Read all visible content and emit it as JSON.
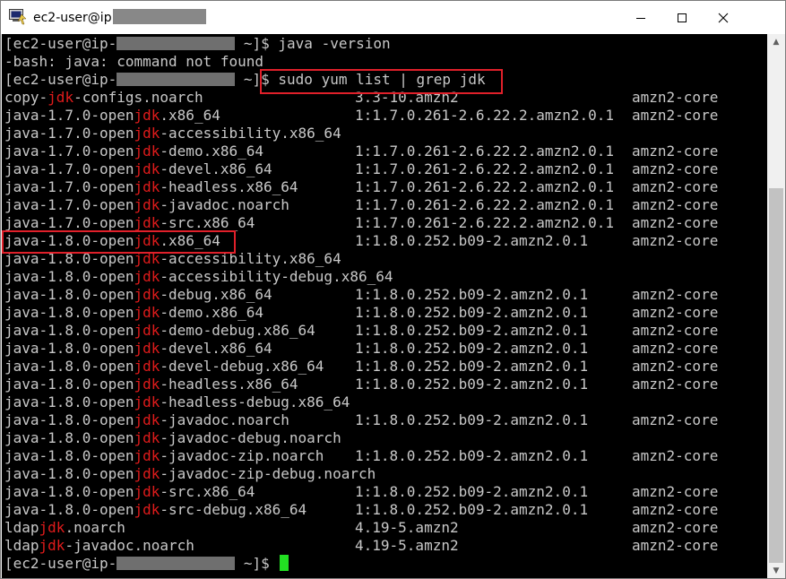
{
  "window": {
    "title": "ec2-user@ip",
    "controls": {
      "minimize": "minimize-icon",
      "maximize": "maximize-icon",
      "close": "close-icon"
    }
  },
  "colors": {
    "terminal_bg": "#000000",
    "terminal_fg": "#c8c8c8",
    "grep_match": "#e01b1b",
    "highlight_box": "#e0202a",
    "cursor": "#22e022"
  },
  "prompt": {
    "user_part": "[ec2-user@ip-",
    "dir_part": " ~]$ "
  },
  "terminal": {
    "cmd1": "java -version",
    "error_line": "-bash: java: command not found",
    "cmd2": "sudo yum list | grep jdk",
    "grep_term": "jdk",
    "packages": [
      {
        "pre": "copy-",
        "post": "-configs.noarch",
        "version": "3.3-10.amzn2",
        "repo": "amzn2-core"
      },
      {
        "pre": "java-1.7.0-open",
        "post": ".x86_64",
        "version": "1:1.7.0.261-2.6.22.2.amzn2.0.1",
        "repo": "amzn2-core"
      },
      {
        "pre": "java-1.7.0-open",
        "post": "-accessibility.x86_64",
        "version": "",
        "repo": ""
      },
      {
        "pre": "java-1.7.0-open",
        "post": "-demo.x86_64",
        "version": "1:1.7.0.261-2.6.22.2.amzn2.0.1",
        "repo": "amzn2-core"
      },
      {
        "pre": "java-1.7.0-open",
        "post": "-devel.x86_64",
        "version": "1:1.7.0.261-2.6.22.2.amzn2.0.1",
        "repo": "amzn2-core"
      },
      {
        "pre": "java-1.7.0-open",
        "post": "-headless.x86_64",
        "version": "1:1.7.0.261-2.6.22.2.amzn2.0.1",
        "repo": "amzn2-core"
      },
      {
        "pre": "java-1.7.0-open",
        "post": "-javadoc.noarch",
        "version": "1:1.7.0.261-2.6.22.2.amzn2.0.1",
        "repo": "amzn2-core"
      },
      {
        "pre": "java-1.7.0-open",
        "post": "-src.x86_64",
        "version": "1:1.7.0.261-2.6.22.2.amzn2.0.1",
        "repo": "amzn2-core"
      },
      {
        "pre": "java-1.8.0-open",
        "post": ".x86_64",
        "version": "1:1.8.0.252.b09-2.amzn2.0.1",
        "repo": "amzn2-core"
      },
      {
        "pre": "java-1.8.0-open",
        "post": "-accessibility.x86_64",
        "version": "",
        "repo": ""
      },
      {
        "pre": "java-1.8.0-open",
        "post": "-accessibility-debug.x86_64",
        "version": "",
        "repo": ""
      },
      {
        "pre": "java-1.8.0-open",
        "post": "-debug.x86_64",
        "version": "1:1.8.0.252.b09-2.amzn2.0.1",
        "repo": "amzn2-core"
      },
      {
        "pre": "java-1.8.0-open",
        "post": "-demo.x86_64",
        "version": "1:1.8.0.252.b09-2.amzn2.0.1",
        "repo": "amzn2-core"
      },
      {
        "pre": "java-1.8.0-open",
        "post": "-demo-debug.x86_64",
        "version": "1:1.8.0.252.b09-2.amzn2.0.1",
        "repo": "amzn2-core"
      },
      {
        "pre": "java-1.8.0-open",
        "post": "-devel.x86_64",
        "version": "1:1.8.0.252.b09-2.amzn2.0.1",
        "repo": "amzn2-core"
      },
      {
        "pre": "java-1.8.0-open",
        "post": "-devel-debug.x86_64",
        "version": "1:1.8.0.252.b09-2.amzn2.0.1",
        "repo": "amzn2-core"
      },
      {
        "pre": "java-1.8.0-open",
        "post": "-headless.x86_64",
        "version": "1:1.8.0.252.b09-2.amzn2.0.1",
        "repo": "amzn2-core"
      },
      {
        "pre": "java-1.8.0-open",
        "post": "-headless-debug.x86_64",
        "version": "",
        "repo": ""
      },
      {
        "pre": "java-1.8.0-open",
        "post": "-javadoc.noarch",
        "version": "1:1.8.0.252.b09-2.amzn2.0.1",
        "repo": "amzn2-core"
      },
      {
        "pre": "java-1.8.0-open",
        "post": "-javadoc-debug.noarch",
        "version": "",
        "repo": ""
      },
      {
        "pre": "java-1.8.0-open",
        "post": "-javadoc-zip.noarch",
        "version": "1:1.8.0.252.b09-2.amzn2.0.1",
        "repo": "amzn2-core"
      },
      {
        "pre": "java-1.8.0-open",
        "post": "-javadoc-zip-debug.noarch",
        "version": "",
        "repo": ""
      },
      {
        "pre": "java-1.8.0-open",
        "post": "-src.x86_64",
        "version": "1:1.8.0.252.b09-2.amzn2.0.1",
        "repo": "amzn2-core"
      },
      {
        "pre": "java-1.8.0-open",
        "post": "-src-debug.x86_64",
        "version": "1:1.8.0.252.b09-2.amzn2.0.1",
        "repo": "amzn2-core"
      },
      {
        "pre": "ldap",
        "post": ".noarch",
        "version": "4.19-5.amzn2",
        "repo": "amzn2-core"
      },
      {
        "pre": "ldap",
        "post": "-javadoc.noarch",
        "version": "4.19-5.amzn2",
        "repo": "amzn2-core"
      }
    ]
  }
}
